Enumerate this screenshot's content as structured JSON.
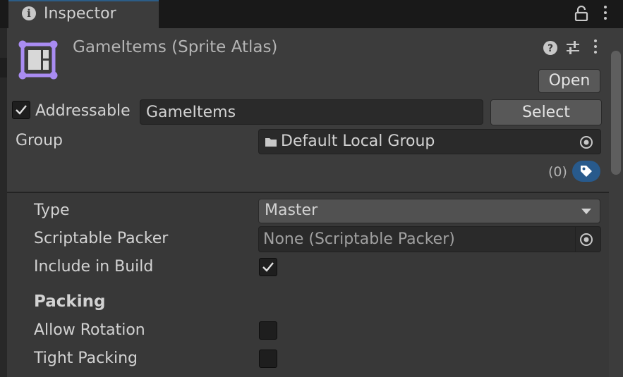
{
  "tab": {
    "label": "Inspector"
  },
  "asset": {
    "title": "GameItems (Sprite Atlas)"
  },
  "header": {
    "open_label": "Open",
    "addressable_label": "Addressable",
    "addressable_checked": true,
    "address_value": "GameItems",
    "select_label": "Select",
    "group_label": "Group",
    "group_value": "Default Local Group",
    "labels_count": "(0)"
  },
  "properties": {
    "type_label": "Type",
    "type_value": "Master",
    "packer_label": "Scriptable Packer",
    "packer_value": "None (Scriptable Packer)",
    "include_label": "Include in Build",
    "include_checked": true,
    "packing_heading": "Packing",
    "allow_rotation_label": "Allow Rotation",
    "allow_rotation_checked": false,
    "tight_packing_label": "Tight Packing",
    "tight_packing_checked": false
  },
  "icons": [
    "info-icon",
    "lock-icon",
    "kebab-menu-icon",
    "sprite-atlas-icon",
    "help-icon",
    "preset-sliders-icon",
    "folder-icon",
    "object-picker-icon",
    "tag-icon",
    "dropdown-arrow-icon",
    "checkmark-icon"
  ],
  "colors": {
    "accent": "#7f5cf0",
    "tag_blue": "#285a8c",
    "panel": "#3c3c3c",
    "background": "#383838"
  }
}
